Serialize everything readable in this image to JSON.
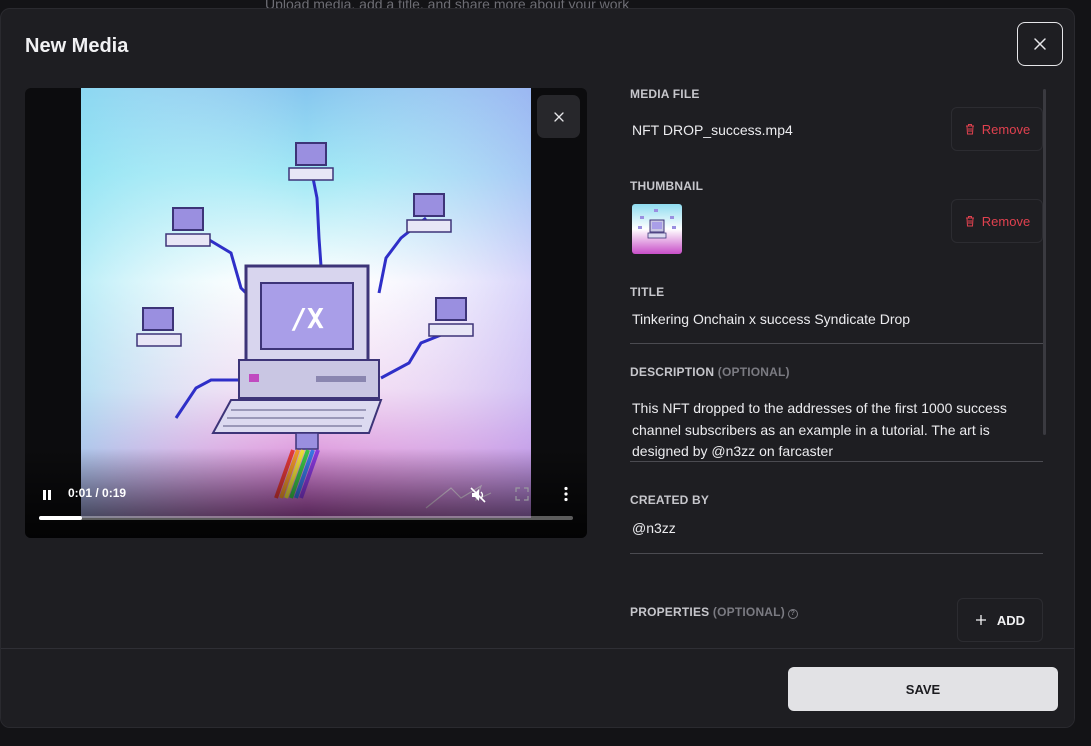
{
  "background": {
    "subtitle": "Upload media, add a title, and share more about your work"
  },
  "modal": {
    "title": "New Media"
  },
  "player": {
    "time": "0:01 / 0:19",
    "progress_percent": 8
  },
  "media_file": {
    "label": "MEDIA FILE",
    "filename": "NFT DROP_success.mp4",
    "remove_label": "Remove"
  },
  "thumbnail": {
    "label": "THUMBNAIL",
    "remove_label": "Remove"
  },
  "title_field": {
    "label": "TITLE",
    "value": "Tinkering Onchain x success Syndicate Drop"
  },
  "description": {
    "label": "DESCRIPTION",
    "optional": "(OPTIONAL)",
    "value": "This NFT dropped to the addresses of the first 1000 success channel subscribers as an example in a tutorial. The art is designed by @n3zz on farcaster"
  },
  "created_by": {
    "label": "CREATED BY",
    "value": "@n3zz"
  },
  "properties": {
    "label": "PROPERTIES",
    "optional": "(OPTIONAL)",
    "add_label": "ADD"
  },
  "footer": {
    "save_label": "SAVE"
  },
  "art": {
    "screen_text": "/X"
  },
  "colors": {
    "accent_red": "#e0414f",
    "save_bg": "#e2e2e5",
    "modal_bg": "#1e1e22"
  }
}
